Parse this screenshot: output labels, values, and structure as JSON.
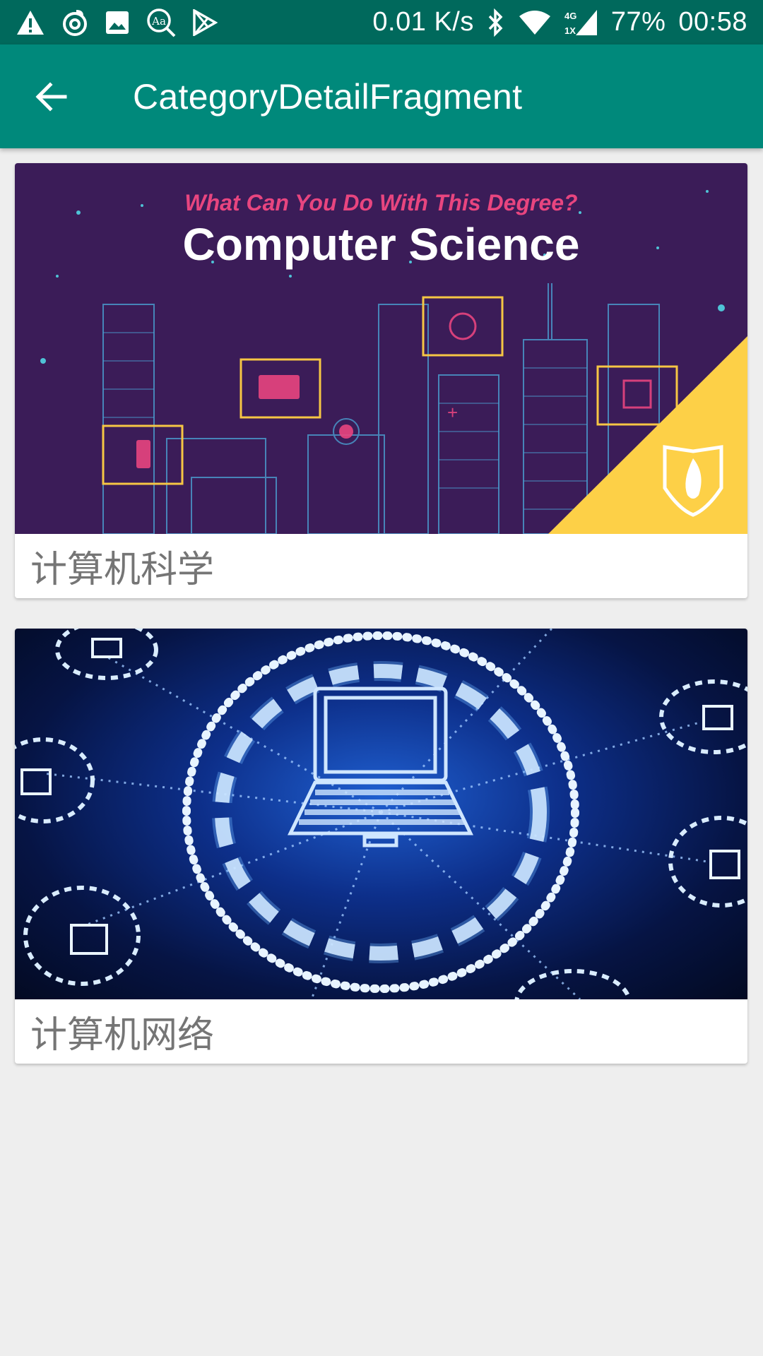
{
  "status_bar": {
    "speed": "0.01 K/s",
    "network_type": "4G",
    "sim_label": "1X",
    "battery": "77%",
    "time": "00:58",
    "icons": [
      "alert-icon",
      "netease-icon",
      "image-icon",
      "dictionary-icon",
      "play-store-icon",
      "bluetooth-icon",
      "wifi-icon",
      "signal-icon"
    ]
  },
  "app_bar": {
    "title": "CategoryDetailFragment",
    "back_icon": "arrow-back-icon"
  },
  "categories": [
    {
      "label": "计算机科学",
      "image_subtitle": "What Can You Do With This Degree?",
      "image_title": "Computer Science"
    },
    {
      "label": "计算机网络"
    }
  ],
  "colors": {
    "status_bar": "#00695c",
    "app_bar": "#00897b",
    "background": "#eeeeee",
    "label_text": "#757575"
  }
}
